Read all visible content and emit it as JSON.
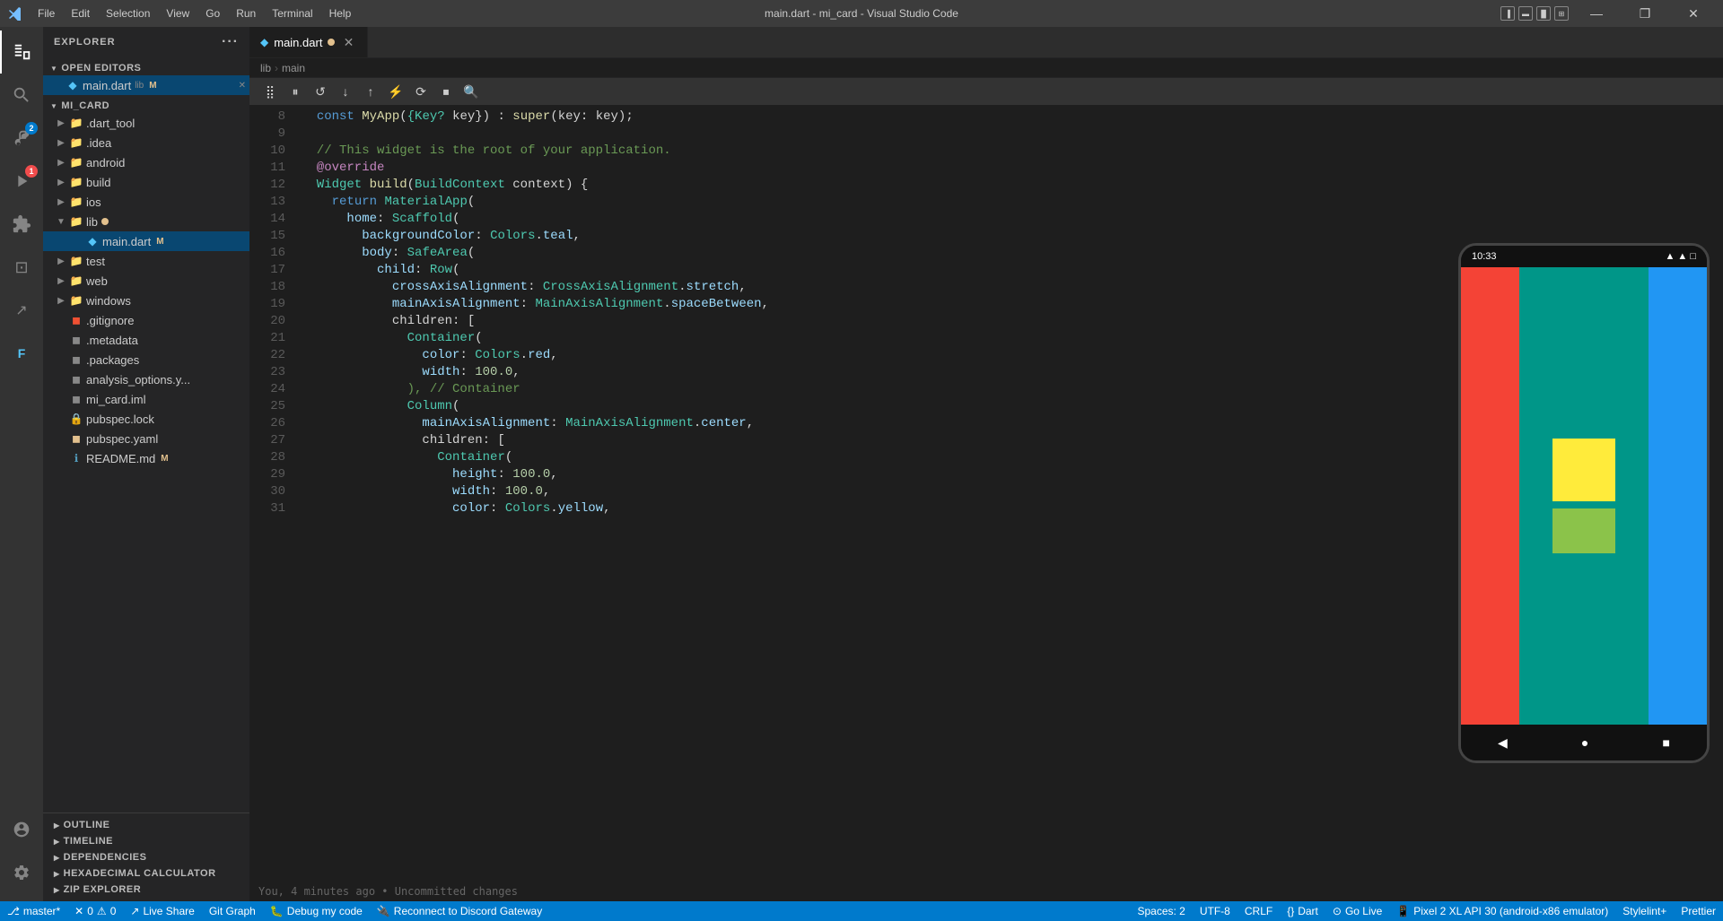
{
  "titlebar": {
    "title": "main.dart - mi_card - Visual Studio Code",
    "menu": [
      "File",
      "Edit",
      "Selection",
      "View",
      "Go",
      "Run",
      "Terminal",
      "Help"
    ],
    "layout_icons": [
      "sidebar",
      "panel",
      "split",
      "grid"
    ],
    "minimize": "—",
    "restore": "❐",
    "close": "✕"
  },
  "activity_bar": {
    "icons": [
      {
        "name": "explorer",
        "symbol": "⎘",
        "active": true
      },
      {
        "name": "search",
        "symbol": "🔍"
      },
      {
        "name": "source-control",
        "symbol": "⎇",
        "badge": "2"
      },
      {
        "name": "run-debug",
        "symbol": "▶",
        "badge": "1",
        "badge_color": "orange"
      },
      {
        "name": "extensions",
        "symbol": "⊞"
      },
      {
        "name": "remote-explorer",
        "symbol": "⊡"
      },
      {
        "name": "live-share",
        "symbol": "↗"
      },
      {
        "name": "flutter",
        "symbol": "F"
      }
    ],
    "bottom_icons": [
      {
        "name": "accounts",
        "symbol": "👤"
      },
      {
        "name": "settings",
        "symbol": "⚙"
      }
    ]
  },
  "sidebar": {
    "header": "Explorer",
    "open_editors_section": "Open Editors",
    "open_editors": [
      {
        "name": "main.dart",
        "path": "lib",
        "badge": "M",
        "active": true
      }
    ],
    "mi_card_section": "MI_CARD",
    "tree": [
      {
        "indent": 0,
        "chevron": "▶",
        "icon": "📁",
        "label": ".dart_tool",
        "type": "folder"
      },
      {
        "indent": 0,
        "chevron": "▶",
        "icon": "📁",
        "label": ".idea",
        "type": "folder"
      },
      {
        "indent": 0,
        "chevron": "▶",
        "icon": "📁",
        "label": "android",
        "type": "folder"
      },
      {
        "indent": 0,
        "chevron": "▶",
        "icon": "📁",
        "label": "build",
        "type": "folder"
      },
      {
        "indent": 0,
        "chevron": "▶",
        "icon": "📁",
        "label": "ios",
        "type": "folder"
      },
      {
        "indent": 0,
        "chevron": "▼",
        "icon": "📁",
        "label": "lib",
        "type": "folder",
        "open": true,
        "dot": true
      },
      {
        "indent": 1,
        "chevron": "",
        "icon": "🎯",
        "label": "main.dart",
        "type": "file",
        "badge": "M",
        "active": true
      },
      {
        "indent": 0,
        "chevron": "▶",
        "icon": "📁",
        "label": "test",
        "type": "folder"
      },
      {
        "indent": 0,
        "chevron": "▶",
        "icon": "📁",
        "label": "web",
        "type": "folder"
      },
      {
        "indent": 0,
        "chevron": "▶",
        "icon": "📁",
        "label": "windows",
        "type": "folder"
      },
      {
        "indent": 0,
        "chevron": "",
        "icon": "📄",
        "label": ".gitignore",
        "type": "file"
      },
      {
        "indent": 0,
        "chevron": "",
        "icon": "📄",
        "label": ".metadata",
        "type": "file"
      },
      {
        "indent": 0,
        "chevron": "",
        "icon": "📄",
        "label": ".packages",
        "type": "file"
      },
      {
        "indent": 0,
        "chevron": "",
        "icon": "📄",
        "label": "analysis_options.y...",
        "type": "file"
      },
      {
        "indent": 0,
        "chevron": "",
        "icon": "📄",
        "label": "mi_card.iml",
        "type": "file"
      },
      {
        "indent": 0,
        "chevron": "",
        "icon": "🔒",
        "label": "pubspec.lock",
        "type": "file"
      },
      {
        "indent": 0,
        "chevron": "",
        "icon": "📝",
        "label": "pubspec.yaml",
        "type": "file"
      },
      {
        "indent": 0,
        "chevron": "",
        "icon": "ℹ",
        "label": "README.md",
        "type": "file",
        "badge": "M"
      }
    ],
    "bottom_sections": [
      "OUTLINE",
      "TIMELINE",
      "DEPENDENCIES",
      "HEXADECIMAL CALCULATOR",
      "ZIP EXPLORER"
    ]
  },
  "editor": {
    "tab_name": "main.dart",
    "tab_badge": "M",
    "breadcrumb": [
      "lib",
      ">",
      "main"
    ],
    "debug_toolbar_buttons": [
      "⣿",
      "⏸",
      "↺",
      "↓",
      "↑",
      "⚡",
      "⟳",
      "⏹",
      "🔍"
    ],
    "lines": [
      {
        "num": 8,
        "content": [
          {
            "text": "  const MyApp(",
            "class": "punct"
          },
          {
            "text": "{Key?",
            "class": "keyword"
          },
          {
            "text": " key}",
            "class": "punct"
          },
          {
            "text": ") : super(key: key);",
            "class": "punct"
          }
        ]
      },
      {
        "num": 9,
        "content": []
      },
      {
        "num": 10,
        "content": [
          {
            "text": "  // This widget is the root of your application.",
            "class": "comment"
          }
        ]
      },
      {
        "num": 11,
        "content": [
          {
            "text": "  ",
            "class": ""
          },
          {
            "text": "@override",
            "class": "decorator"
          }
        ]
      },
      {
        "num": 12,
        "content": [
          {
            "text": "  ",
            "class": ""
          },
          {
            "text": "Widget",
            "class": "class-name"
          },
          {
            "text": " build(",
            "class": "punct"
          },
          {
            "text": "BuildContext",
            "class": "class-name"
          },
          {
            "text": " context) {",
            "class": "punct"
          }
        ]
      },
      {
        "num": 13,
        "content": [
          {
            "text": "    return ",
            "class": "keyword"
          },
          {
            "text": "MaterialApp(",
            "class": "class-name"
          }
        ]
      },
      {
        "num": 14,
        "content": [
          {
            "text": "      home: ",
            "class": "property"
          },
          {
            "text": "Scaffold(",
            "class": "class-name"
          }
        ]
      },
      {
        "num": 15,
        "content": [
          {
            "text": "        backgroundColor: ",
            "class": "property"
          },
          {
            "text": "Colors",
            "class": "class-name"
          },
          {
            "text": ".",
            "class": "punct"
          },
          {
            "text": "teal",
            "class": "property"
          },
          {
            "text": ",",
            "class": "punct"
          }
        ]
      },
      {
        "num": 16,
        "content": [
          {
            "text": "        body: ",
            "class": "property"
          },
          {
            "text": "SafeArea(",
            "class": "class-name"
          }
        ]
      },
      {
        "num": 17,
        "content": [
          {
            "text": "          child: ",
            "class": "property"
          },
          {
            "text": "Row(",
            "class": "class-name"
          }
        ]
      },
      {
        "num": 18,
        "content": [
          {
            "text": "            crossAxisAlignment: ",
            "class": "property"
          },
          {
            "text": "CrossAxisAlignment",
            "class": "class-name"
          },
          {
            "text": ".",
            "class": "punct"
          },
          {
            "text": "stretch",
            "class": "property"
          },
          {
            "text": ",",
            "class": "punct"
          }
        ]
      },
      {
        "num": 19,
        "content": [
          {
            "text": "            mainAxisAlignment: ",
            "class": "property"
          },
          {
            "text": "MainAxisAlignment",
            "class": "class-name"
          },
          {
            "text": ".",
            "class": "punct"
          },
          {
            "text": "spaceBetween",
            "class": "property"
          },
          {
            "text": ",",
            "class": "punct"
          }
        ]
      },
      {
        "num": 20,
        "content": [
          {
            "text": "            children: [",
            "class": "punct"
          }
        ]
      },
      {
        "num": 21,
        "content": [
          {
            "text": "              ",
            "class": ""
          },
          {
            "text": "Container(",
            "class": "class-name"
          }
        ]
      },
      {
        "num": 22,
        "content": [
          {
            "text": "                color: ",
            "class": "property"
          },
          {
            "text": "Colors",
            "class": "class-name"
          },
          {
            "text": ".",
            "class": "punct"
          },
          {
            "text": "red",
            "class": "property"
          },
          {
            "text": ",",
            "class": "punct"
          }
        ]
      },
      {
        "num": 23,
        "content": [
          {
            "text": "                width: ",
            "class": "property"
          },
          {
            "text": "100.0",
            "class": "value"
          },
          {
            "text": ",",
            "class": "punct"
          }
        ]
      },
      {
        "num": 24,
        "content": [
          {
            "text": "              ), // Container",
            "class": "comment"
          }
        ]
      },
      {
        "num": 25,
        "content": [
          {
            "text": "              ",
            "class": ""
          },
          {
            "text": "Column(",
            "class": "class-name"
          }
        ]
      },
      {
        "num": 26,
        "content": [
          {
            "text": "                mainAxisAlignment: ",
            "class": "property"
          },
          {
            "text": "MainAxisAlignment",
            "class": "class-name"
          },
          {
            "text": ".",
            "class": "punct"
          },
          {
            "text": "center",
            "class": "property"
          },
          {
            "text": ",",
            "class": "punct"
          }
        ]
      },
      {
        "num": 27,
        "content": [
          {
            "text": "                children: [",
            "class": "punct"
          }
        ]
      },
      {
        "num": 28,
        "content": [
          {
            "text": "                  ",
            "class": ""
          },
          {
            "text": "Container(",
            "class": "class-name"
          }
        ]
      },
      {
        "num": 29,
        "content": [
          {
            "text": "                    height: ",
            "class": "property"
          },
          {
            "text": "100.0",
            "class": "value"
          },
          {
            "text": ",",
            "class": "punct"
          }
        ]
      },
      {
        "num": 30,
        "content": [
          {
            "text": "                    width: ",
            "class": "property"
          },
          {
            "text": "100.0",
            "class": "value"
          },
          {
            "text": ",",
            "class": "punct"
          }
        ]
      },
      {
        "num": 31,
        "content": [
          {
            "text": "                    color: ",
            "class": "property"
          },
          {
            "text": "Colors",
            "class": "class-name"
          },
          {
            "text": ".",
            "class": "punct"
          },
          {
            "text": "yellow",
            "class": "property"
          },
          {
            "text": ",",
            "class": "punct"
          }
        ],
        "bulb": true
      }
    ],
    "status_message": "You, 4 minutes ago • Uncommitted changes"
  },
  "phone": {
    "time": "10:33",
    "signal_icons": "▲▲▲",
    "battery": "□",
    "colors": {
      "red": "#f44336",
      "teal": "#009688",
      "blue": "#2196f3",
      "yellow": "#ffeb3b",
      "green": "#8bc34a"
    }
  },
  "status_bar": {
    "branch": "master*",
    "errors": "0",
    "warnings": "0",
    "live_share": "Live Share",
    "git_graph": "Git Graph",
    "debug_my_code": "Debug my code",
    "reconnect": "Reconnect to Discord Gateway",
    "spaces": "Spaces: 2",
    "encoding": "UTF-8",
    "line_ending": "CRLF",
    "language": "Dart",
    "go_live": "Go Live",
    "device": "Pixel 2 XL API 30 (android-x86 emulator)",
    "stylelint": "Stylelint+",
    "prettier": "Prettier"
  }
}
